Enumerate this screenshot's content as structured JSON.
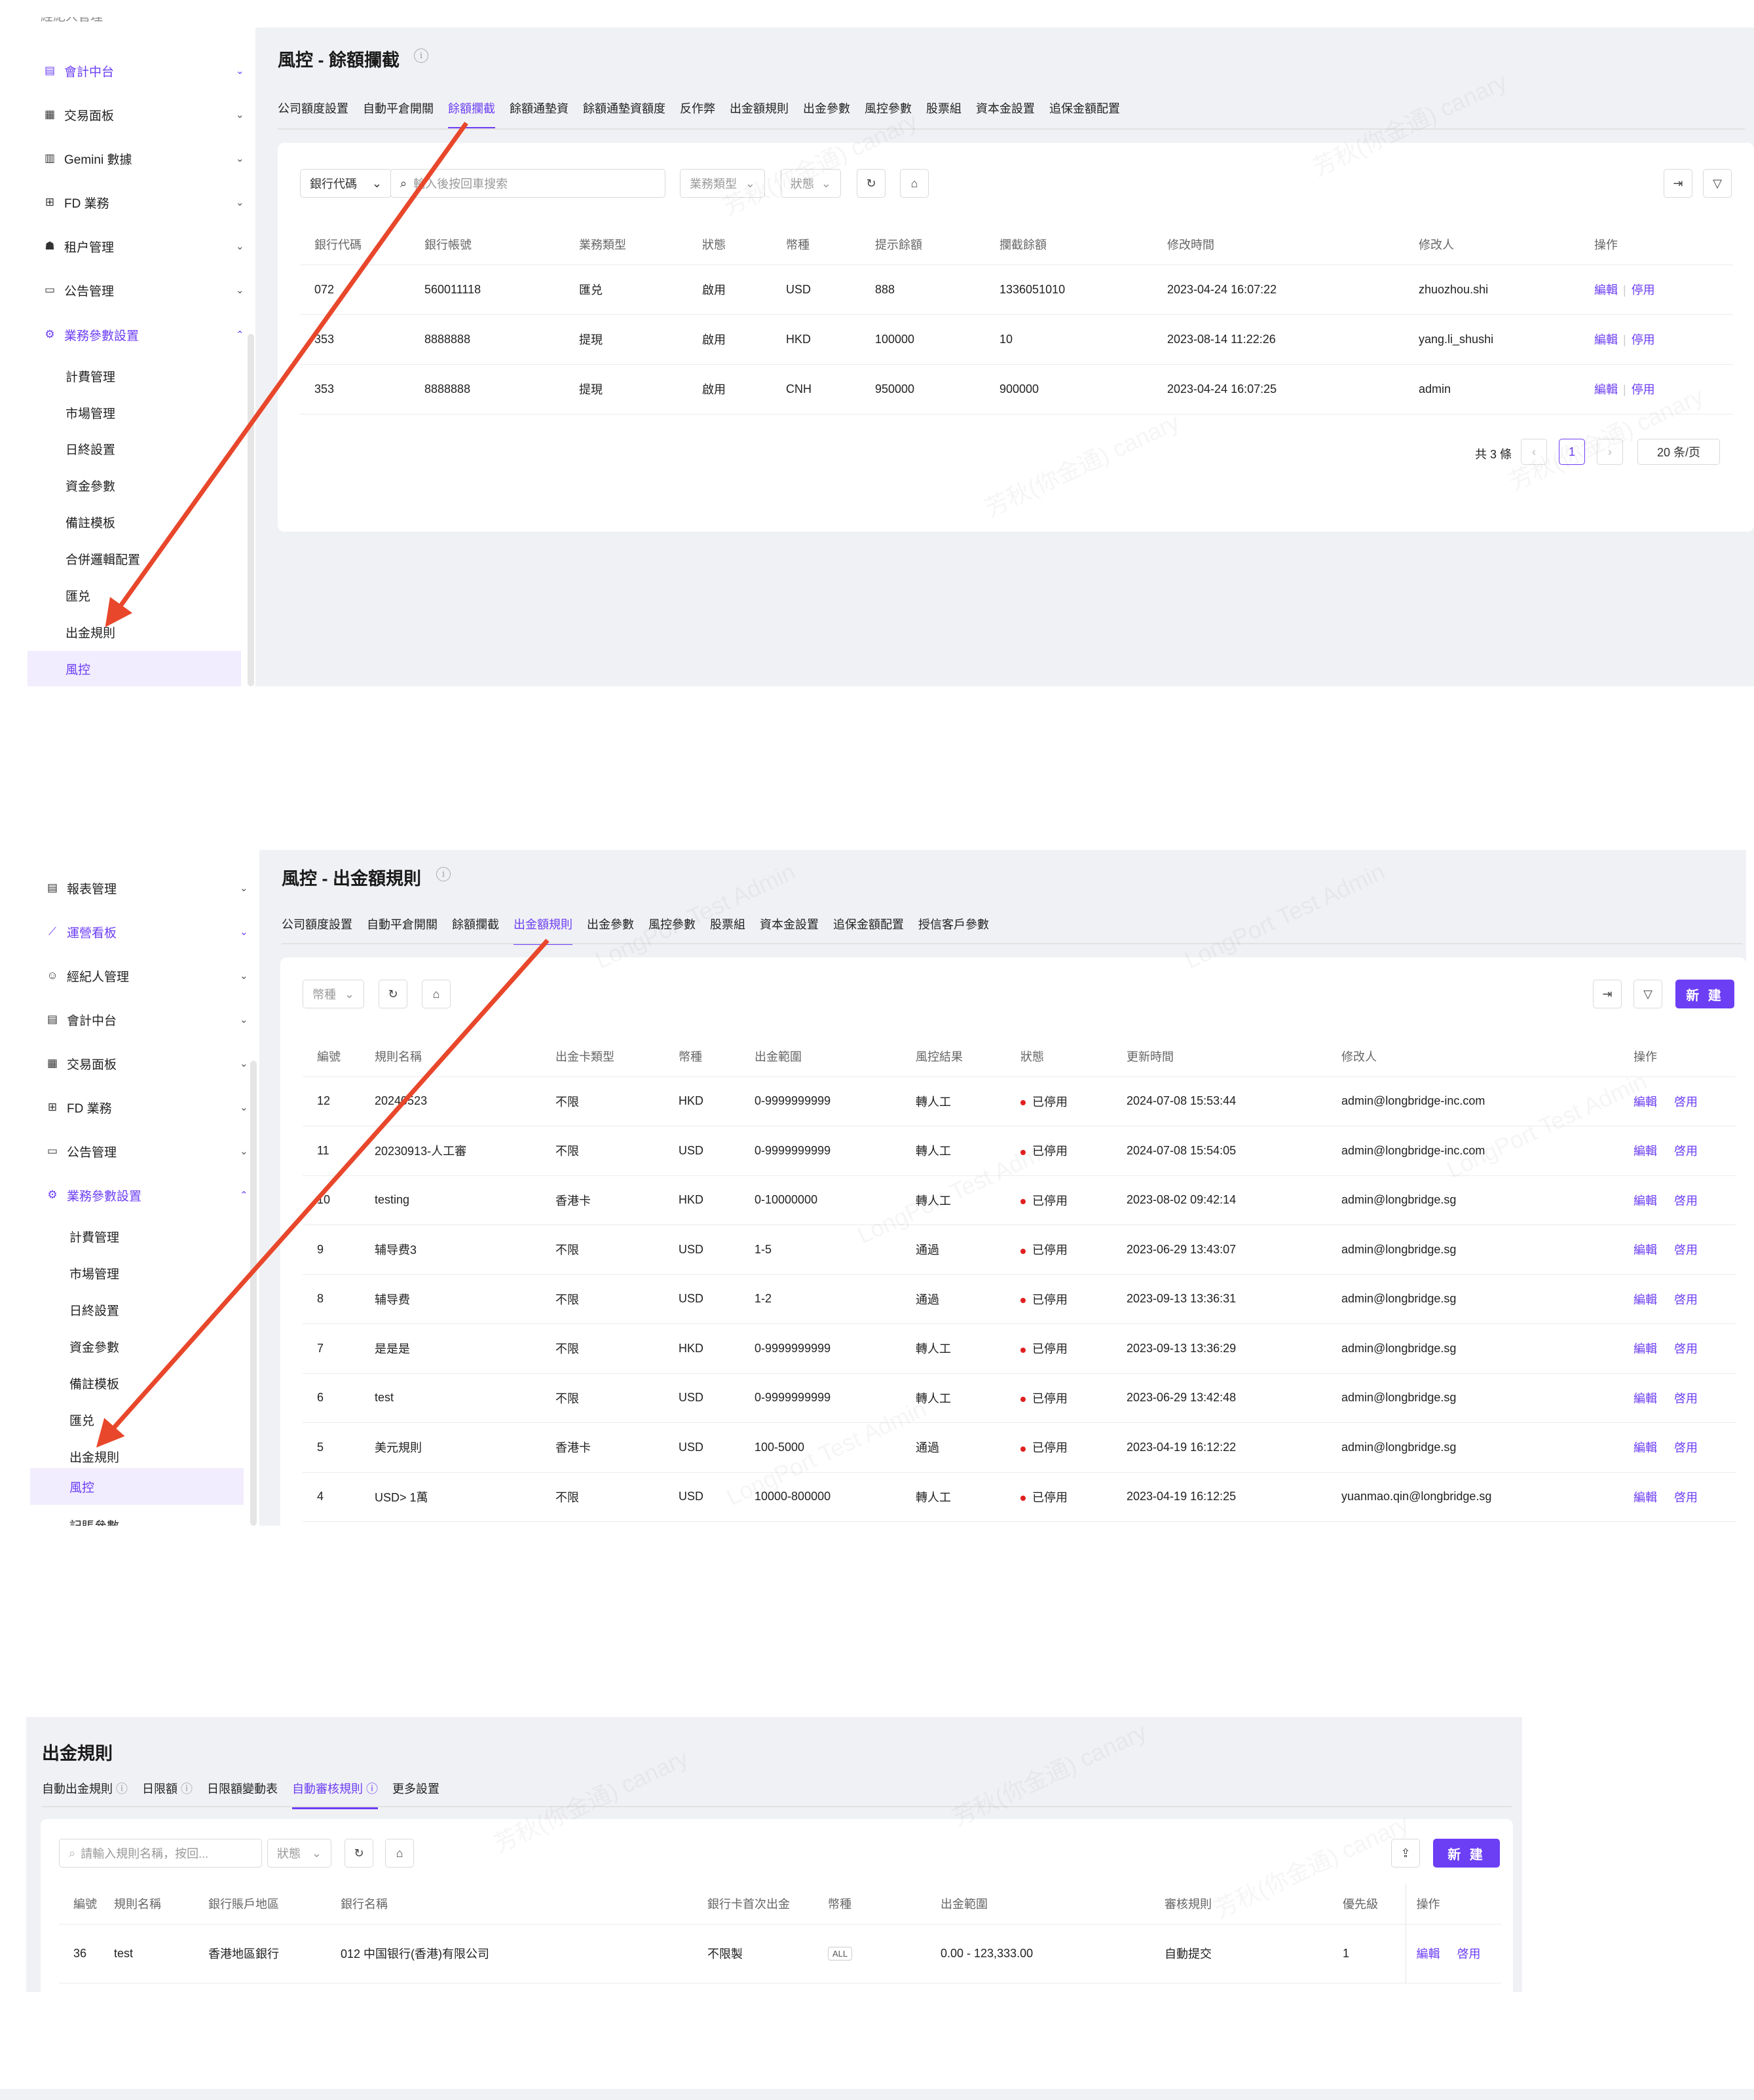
{
  "section1": {
    "sidebar": {
      "top_cut_label": "經紀人管理",
      "items": [
        {
          "label": "會計中台",
          "icon": "ledger-icon",
          "active": true
        },
        {
          "label": "交易面板",
          "icon": "board-icon"
        },
        {
          "label": "Gemini 數據",
          "icon": "chart-icon"
        },
        {
          "label": "FD 業務",
          "icon": "bank-icon"
        },
        {
          "label": "租户管理",
          "icon": "users-icon"
        },
        {
          "label": "公告管理",
          "icon": "message-icon"
        },
        {
          "label": "業務參數設置",
          "icon": "gear-icon",
          "active": true,
          "expanded": true
        }
      ],
      "subitems": [
        "計費管理",
        "市場管理",
        "日終設置",
        "資金參數",
        "備註模板",
        "合併邏輯配置",
        "匯兑",
        "出金規則"
      ],
      "selected": "風控"
    },
    "title": "風控 - 餘額攔截",
    "tabs": [
      "公司額度設置",
      "自動平倉開關",
      "餘額攔截",
      "餘額通墊資",
      "餘額通墊資額度",
      "反作弊",
      "出金額規則",
      "出金參數",
      "風控參數",
      "股票組",
      "資本金設置",
      "追保金額配置"
    ],
    "active_tab": "餘額攔截",
    "filters": {
      "bank_code": "銀行代碼",
      "search_placeholder": "輸入後按回車搜索",
      "biz_type": "業務類型",
      "status": "狀態"
    },
    "columns": [
      "銀行代碼",
      "銀行帳號",
      "業務類型",
      "狀態",
      "幣種",
      "提示餘額",
      "攔截餘額",
      "修改時間",
      "修改人",
      "操作"
    ],
    "rows": [
      [
        "072",
        "560011118",
        "匯兑",
        "啟用",
        "USD",
        "888",
        "1336051010",
        "2023-04-24 16:07:22",
        "zhuozhou.shi"
      ],
      [
        "353",
        "8888888",
        "提現",
        "啟用",
        "HKD",
        "100000",
        "10",
        "2023-08-14 11:22:26",
        "yang.li_shushi"
      ],
      [
        "353",
        "8888888",
        "提現",
        "啟用",
        "CNH",
        "950000",
        "900000",
        "2023-04-24 16:07:25",
        "admin"
      ]
    ],
    "edit_label": "編輯",
    "disable_label": "停用",
    "pagination": {
      "total": "共 3 條",
      "page": "1",
      "page_size": "20 条/页"
    },
    "watermark": "芳秋(你金通) canary"
  },
  "section2": {
    "sidebar": {
      "items": [
        {
          "label": "報表管理",
          "icon": "report-icon"
        },
        {
          "label": "運營看板",
          "icon": "trend-icon",
          "active": true
        },
        {
          "label": "經紀人管理",
          "icon": "person-icon"
        },
        {
          "label": "會計中台",
          "icon": "ledger-icon"
        },
        {
          "label": "交易面板",
          "icon": "board-icon"
        },
        {
          "label": "FD 業務",
          "icon": "bank-icon"
        },
        {
          "label": "公告管理",
          "icon": "message-icon"
        },
        {
          "label": "業務參數設置",
          "icon": "gear-icon",
          "active": true,
          "expanded": true
        }
      ],
      "subitems": [
        "計費管理",
        "市場管理",
        "日終設置",
        "資金參數",
        "備註模板",
        "匯兑",
        "出金規則"
      ],
      "selected": "風控",
      "bottom_cut_label": "記賬參數"
    },
    "title": "風控 - 出金額規則",
    "tabs": [
      "公司額度設置",
      "自動平倉開關",
      "餘額攔截",
      "出金額規則",
      "出金參數",
      "風控參數",
      "股票組",
      "資本金設置",
      "追保金額配置",
      "授信客戶參數"
    ],
    "active_tab": "出金額規則",
    "filters": {
      "currency": "幣種"
    },
    "new_label": "新 建",
    "columns": [
      "編號",
      "規則名稱",
      "出金卡類型",
      "幣種",
      "出金範圍",
      "風控結果",
      "狀態",
      "更新時間",
      "修改人",
      "操作"
    ],
    "rows": [
      [
        "12",
        "20240523",
        "不限",
        "HKD",
        "0-9999999999",
        "轉人工",
        "已停用",
        "2024-07-08 15:53:44",
        "admin@longbridge-inc.com"
      ],
      [
        "11",
        "20230913-人工審",
        "不限",
        "USD",
        "0-9999999999",
        "轉人工",
        "已停用",
        "2024-07-08 15:54:05",
        "admin@longbridge-inc.com"
      ],
      [
        "10",
        "testing",
        "香港卡",
        "HKD",
        "0-10000000",
        "轉人工",
        "已停用",
        "2023-08-02 09:42:14",
        "admin@longbridge.sg"
      ],
      [
        "9",
        "辅导费3",
        "不限",
        "USD",
        "1-5",
        "通過",
        "已停用",
        "2023-06-29 13:43:07",
        "admin@longbridge.sg"
      ],
      [
        "8",
        "辅导费",
        "不限",
        "USD",
        "1-2",
        "通過",
        "已停用",
        "2023-09-13 13:36:31",
        "admin@longbridge.sg"
      ],
      [
        "7",
        "是是是",
        "不限",
        "HKD",
        "0-9999999999",
        "轉人工",
        "已停用",
        "2023-09-13 13:36:29",
        "admin@longbridge.sg"
      ],
      [
        "6",
        "test",
        "不限",
        "USD",
        "0-9999999999",
        "轉人工",
        "已停用",
        "2023-06-29 13:42:48",
        "admin@longbridge.sg"
      ],
      [
        "5",
        "美元規則",
        "香港卡",
        "USD",
        "100-5000",
        "通過",
        "已停用",
        "2023-04-19 16:12:22",
        "admin@longbridge.sg"
      ],
      [
        "4",
        "USD> 1萬",
        "不限",
        "USD",
        "10000-800000",
        "轉人工",
        "已停用",
        "2023-04-19 16:12:25",
        "yuanmao.qin@longbridge.sg"
      ]
    ],
    "edit_label": "編輯",
    "enable_label": "啓用",
    "watermark": "LongPort Test Admin"
  },
  "section3": {
    "title": "出金規則",
    "tabs": [
      "自動出金規則",
      "日限額",
      "日限額變動表",
      "自動審核規則",
      "更多設置"
    ],
    "tabs_with_info": [
      true,
      true,
      false,
      true,
      false
    ],
    "active_tab": "自動審核規則",
    "filters": {
      "search_placeholder": "請輸入規則名稱，按回...",
      "status": "狀態"
    },
    "new_label": "新 建",
    "columns": [
      "編號",
      "規則名稱",
      "銀行賬戶地區",
      "銀行名稱",
      "銀行卡首次出金",
      "幣種",
      "出金範圍",
      "審核規則",
      "優先級",
      "操作"
    ],
    "rows": [
      [
        "36",
        "test",
        "香港地區銀行",
        "012 中国银行(香港)有限公司",
        "不限製",
        "ALL",
        "0.00 - 123,333.00",
        "自動提交",
        "1"
      ]
    ],
    "edit_label": "編輯",
    "enable_label": "啓用",
    "watermark": "芳秋(你金通) canary"
  },
  "colors": {
    "accent": "#6c3ef4",
    "arrow": "#e8472b",
    "page_bg": "#f0f1f4",
    "status_red": "#e02020"
  }
}
